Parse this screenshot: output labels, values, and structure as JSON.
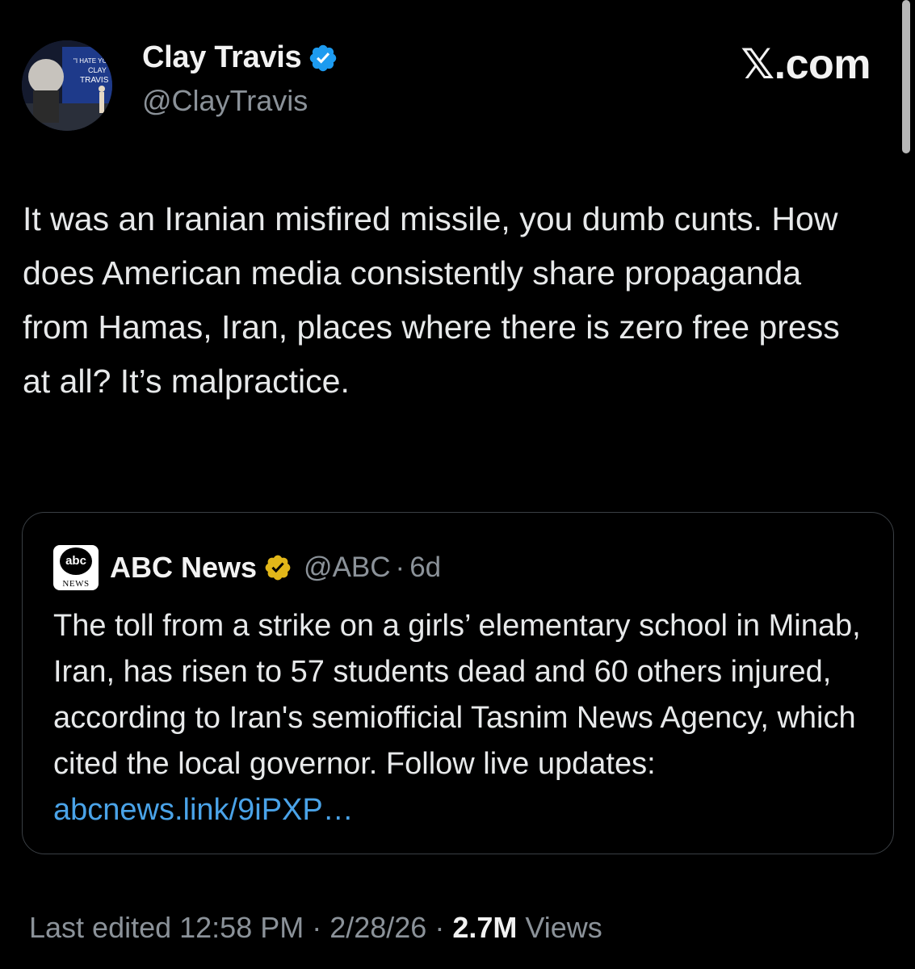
{
  "author": {
    "name": "Clay Travis",
    "handle": "@ClayTravis",
    "avatar_caption": "\"I HATE YOU CLAY TRAVIS\""
  },
  "brand": "𝕏.com",
  "tweet": {
    "text": "It was an Iranian misfired missile, you dumb cunts. How does American media consistently share propaganda from Hamas, Iran, places where there is zero free press at all? It’s malpractice."
  },
  "quote": {
    "logo_text": "abc",
    "logo_sub": "NEWS",
    "name": "ABC News",
    "handle": "@ABC",
    "separator": "·",
    "age": "6d",
    "text": "The toll from a strike on a girls’ elementary school in Minab, Iran, has risen to 57 students dead and 60 others injured, according to Iran's semiofficial Tasnim News Agency, which cited the local governor. Follow live updates: ",
    "link": "abcnews.link/9iPXP…"
  },
  "footer": {
    "edited_label": "Last edited 12:58 PM · 2/28/26",
    "separator": " · ",
    "views_count": "2.7M",
    "views_label": " Views"
  },
  "colors": {
    "background": "#000000",
    "text": "#e7e9ea",
    "muted": "#8b9299",
    "link": "#4aa3e8",
    "verified_blue": "#1d9bf0",
    "verified_gold": "#e2b719",
    "card_border": "#3a3f44"
  },
  "icons": {
    "verified": "verified-blue-check-icon",
    "org_verified": "verified-gold-check-icon"
  }
}
